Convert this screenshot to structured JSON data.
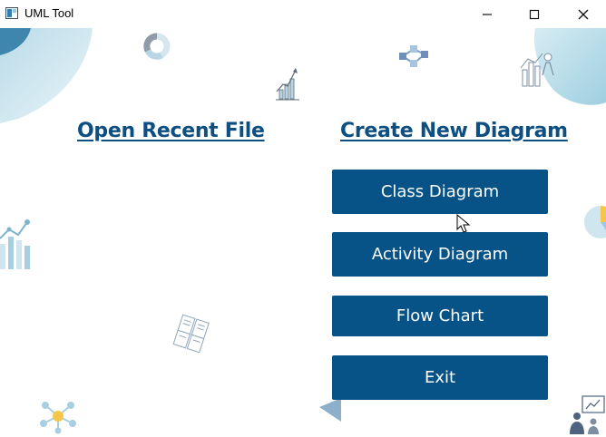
{
  "window": {
    "title": "UML Tool"
  },
  "sections": {
    "open_recent": "Open Recent File",
    "create_new": "Create New Diagram"
  },
  "buttons": {
    "class_diagram": "Class Diagram",
    "activity_diagram": "Activity Diagram",
    "flow_chart": "Flow Chart",
    "exit": "Exit"
  },
  "colors": {
    "accent": "#0e4f82",
    "button_bg": "#075387",
    "button_text": "#ffffff",
    "decor_light": "#cfe6f0"
  },
  "icons": [
    "app-icon",
    "minimize-icon",
    "maximize-icon",
    "close-icon",
    "donut-chart-icon",
    "network-nodes-icon",
    "growth-chart-icon",
    "analytics-team-icon",
    "bar-graph-icon",
    "pie-chart-icon",
    "document-stack-icon",
    "hub-network-icon",
    "presentation-icon",
    "mouse-cursor-icon"
  ]
}
